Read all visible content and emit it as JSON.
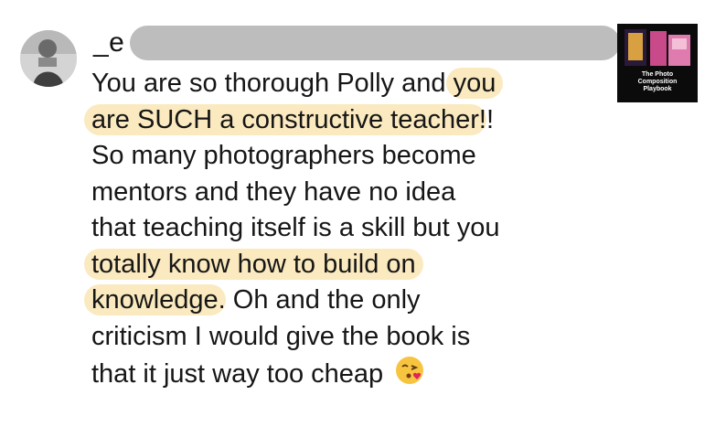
{
  "comment": {
    "username_prefix": "_e",
    "lines": [
      [
        {
          "t": "You are so thorough Polly and ",
          "h": false
        },
        {
          "t": "you",
          "h": true
        }
      ],
      [
        {
          "t": "are SUCH a constructive teacher",
          "h": true
        },
        {
          "t": "!!",
          "h": false
        }
      ],
      [
        {
          "t": "So many photographers become",
          "h": false
        }
      ],
      [
        {
          "t": "mentors and they have no idea",
          "h": false
        }
      ],
      [
        {
          "t": "that teaching itself is a skill but you",
          "h": false
        }
      ],
      [
        {
          "t": "totally know how to build on",
          "h": true
        }
      ],
      [
        {
          "t": "knowledge",
          "h": true
        },
        {
          "t": ". Oh and the only",
          "h": false
        }
      ],
      [
        {
          "t": "criticism I  would give the book is",
          "h": false
        }
      ],
      [
        {
          "t": "that it  just way too cheap ",
          "h": false
        }
      ]
    ],
    "highlight_color": "#fbeabf",
    "trailing_emoji": "face-blowing-a-kiss-icon"
  },
  "book_thumbnail": {
    "title_line1": "The Photo",
    "title_line2": "Composition",
    "title_line3": "Playbook"
  }
}
